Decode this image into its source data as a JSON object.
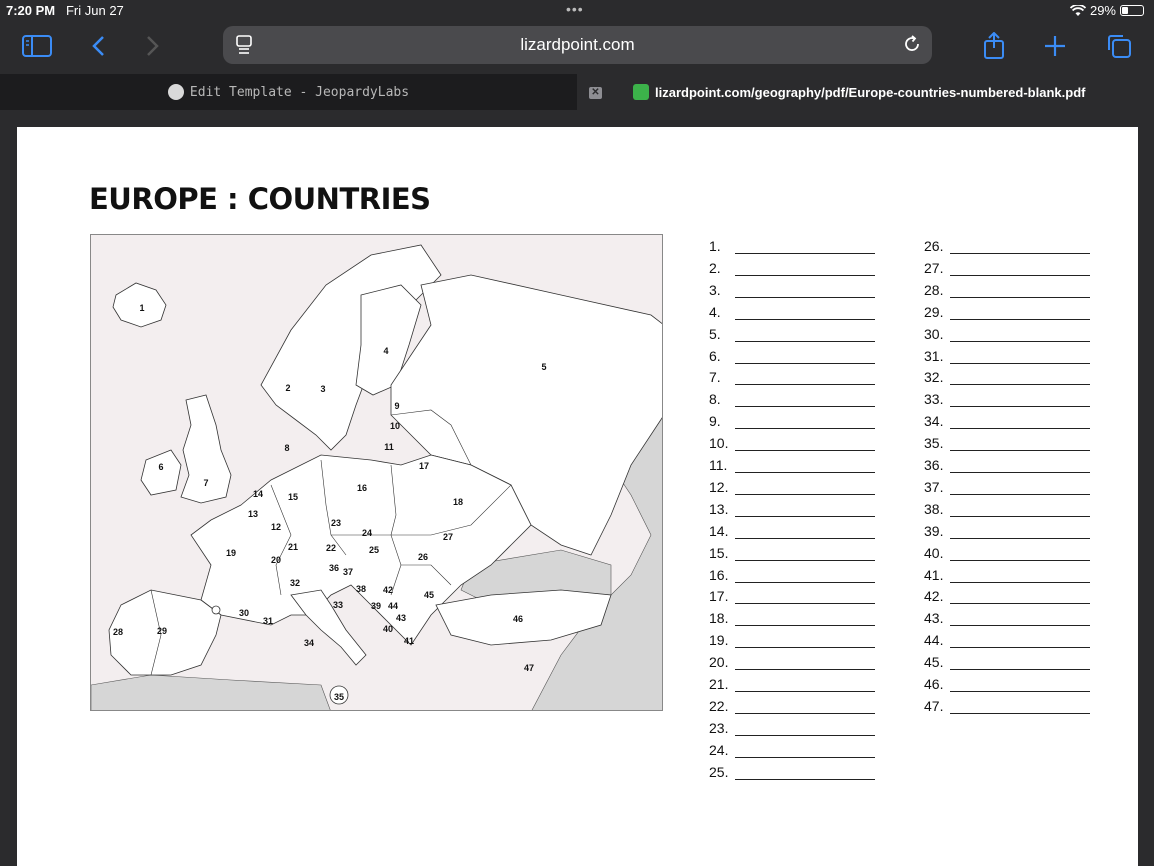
{
  "status": {
    "time": "7:20 PM",
    "date": "Fri Jun 27",
    "battery": "29%",
    "icons": [
      "wifi-icon",
      "battery-icon"
    ]
  },
  "toolbar": {
    "url": "lizardpoint.com",
    "icons": [
      "sidebar-icon",
      "back-icon",
      "forward-icon",
      "reader-icon",
      "reload-icon",
      "share-icon",
      "new-tab-icon",
      "tabs-icon"
    ]
  },
  "tabs": [
    {
      "label": "Edit Template - JeopardyLabs",
      "active": false
    },
    {
      "label": "lizardpoint.com/geography/pdf/Europe-countries-numbered-blank.pdf",
      "active": true
    }
  ],
  "document": {
    "title": "EUROPE : COUNTRIES",
    "map_labels": [
      "1",
      "2",
      "3",
      "4",
      "5",
      "6",
      "7",
      "8",
      "9",
      "10",
      "11",
      "12",
      "13",
      "14",
      "15",
      "16",
      "17",
      "18",
      "19",
      "20",
      "21",
      "22",
      "23",
      "24",
      "25",
      "26",
      "27",
      "28",
      "29",
      "30",
      "31",
      "32",
      "33",
      "34",
      "35",
      "36",
      "37",
      "38",
      "39",
      "40",
      "41",
      "42",
      "43",
      "44",
      "45",
      "46",
      "47"
    ],
    "answers_left": [
      "1.",
      "2.",
      "3.",
      "4.",
      "5.",
      "6.",
      "7.",
      "8.",
      "9.",
      "10.",
      "11.",
      "12.",
      "13.",
      "14.",
      "15.",
      "16.",
      "17.",
      "18.",
      "19.",
      "20.",
      "21.",
      "22.",
      "23.",
      "24.",
      "25."
    ],
    "answers_right": [
      "26.",
      "27.",
      "28.",
      "29.",
      "30.",
      "31.",
      "32.",
      "33.",
      "34.",
      "35.",
      "36.",
      "37.",
      "38.",
      "39.",
      "40.",
      "41.",
      "42.",
      "43.",
      "44.",
      "45.",
      "46.",
      "47."
    ]
  }
}
